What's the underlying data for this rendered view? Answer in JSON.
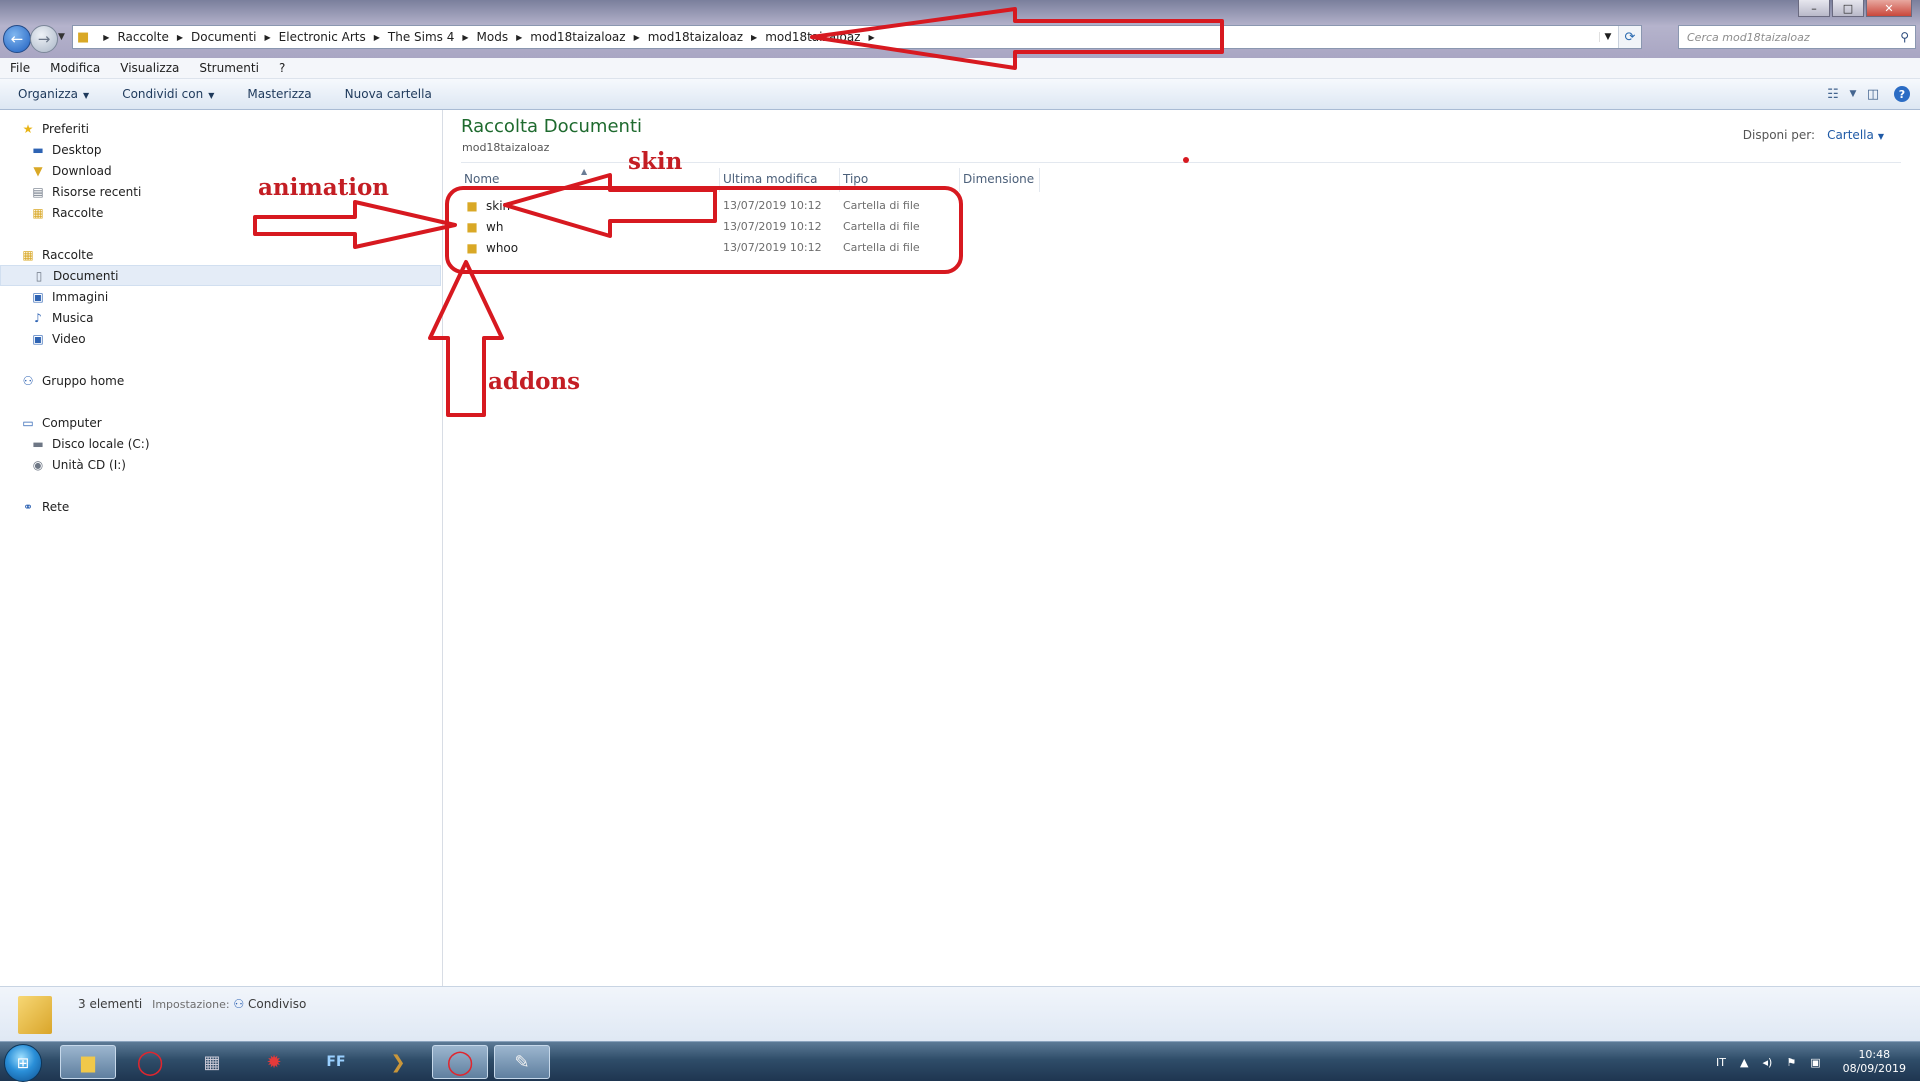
{
  "window": {
    "minimize": "–",
    "maximize": "□",
    "close": "✕"
  },
  "address": {
    "crumbs": [
      "Raccolte",
      "Documenti",
      "Electronic Arts",
      "The Sims 4",
      "Mods",
      "mod18taizaloaz",
      "mod18taizaloaz",
      "mod18taizaloaz"
    ],
    "search_placeholder": "Cerca mod18taizaloaz"
  },
  "menu": [
    "File",
    "Modifica",
    "Visualizza",
    "Strumenti",
    "?"
  ],
  "commands": {
    "organize": "Organizza",
    "share": "Condividi con",
    "burn": "Masterizza",
    "new_folder": "Nuova cartella"
  },
  "nav": {
    "favorites": {
      "label": "Preferiti",
      "items": [
        "Desktop",
        "Download",
        "Risorse recenti",
        "Raccolte"
      ]
    },
    "libraries": {
      "label": "Raccolte",
      "items": [
        "Documenti",
        "Immagini",
        "Musica",
        "Video"
      ]
    },
    "homegroup": "Gruppo home",
    "computer": {
      "label": "Computer",
      "items": [
        "Disco locale (C:)",
        "Unità CD (I:)"
      ]
    },
    "network": "Rete"
  },
  "content": {
    "title": "Raccolta Documenti",
    "subtitle": "mod18taizaloaz",
    "arrange_label": "Disponi per:",
    "arrange_value": "Cartella",
    "columns": [
      "Nome",
      "Ultima modifica",
      "Tipo",
      "Dimensione"
    ],
    "files": [
      {
        "name": "skin",
        "modified": "13/07/2019 10:12",
        "type": "Cartella di file"
      },
      {
        "name": "wh",
        "modified": "13/07/2019 10:12",
        "type": "Cartella di file"
      },
      {
        "name": "whoo",
        "modified": "13/07/2019 10:12",
        "type": "Cartella di file"
      }
    ]
  },
  "details": {
    "count": "3 elementi",
    "setting_label": "Impostazione:",
    "setting_value": "Condiviso"
  },
  "tray": {
    "lang": "IT",
    "time": "10:48",
    "date": "08/09/2019"
  },
  "annotations": {
    "animation": "animation",
    "skin": "skin",
    "addons": "addons",
    "color": "#d71920"
  }
}
